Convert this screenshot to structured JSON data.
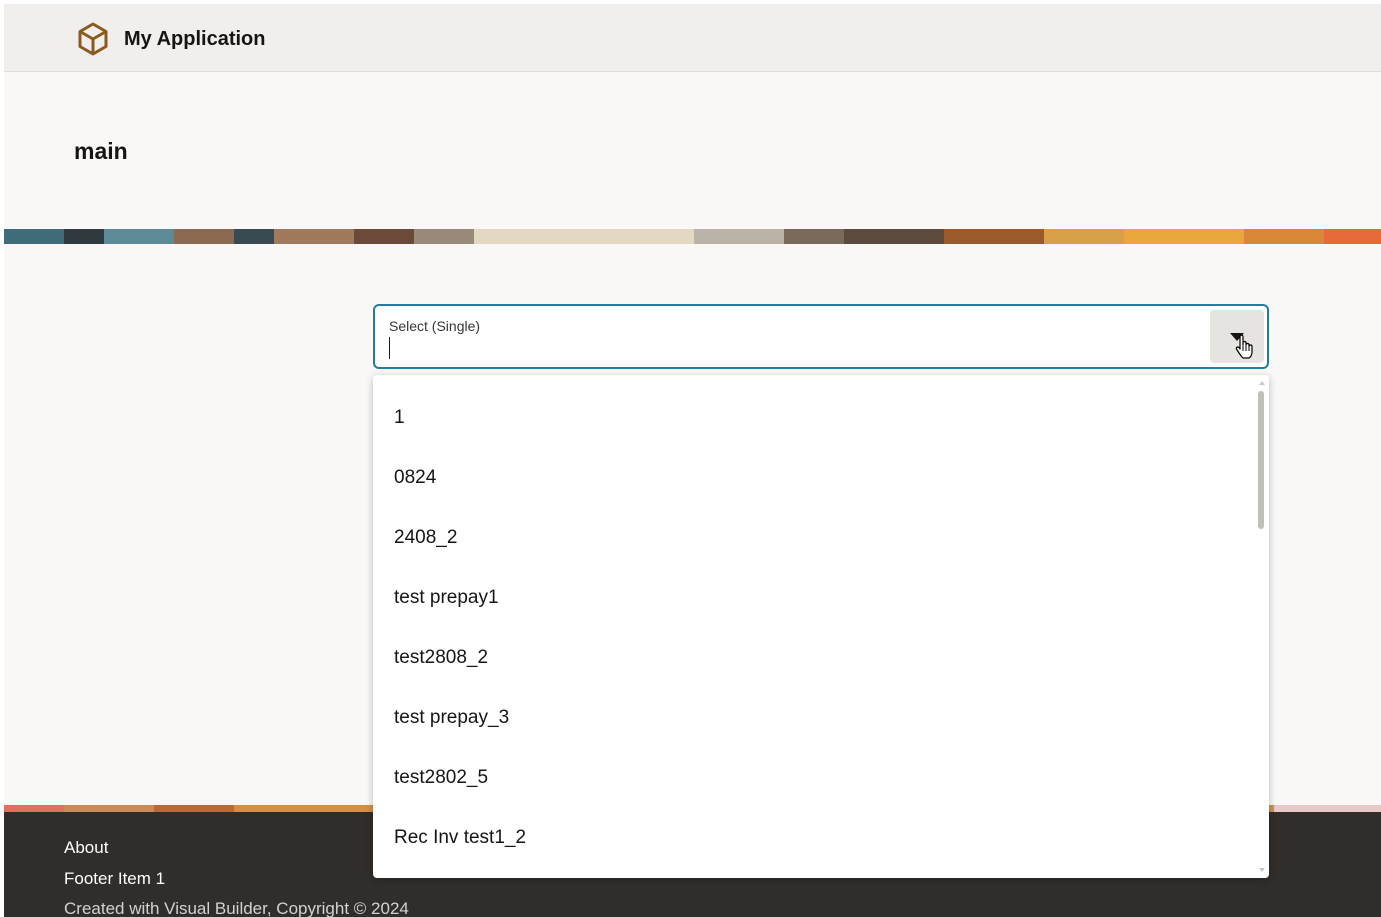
{
  "header": {
    "app_title": "My Application",
    "logo_icon": "cube-icon"
  },
  "page": {
    "title": "main"
  },
  "select": {
    "label": "Select (Single)",
    "value": "",
    "dropdown_icon": "caret-down-icon",
    "focus_color": "#227e9e"
  },
  "listbox": {
    "options": [
      "1",
      "0824",
      "2408_2",
      "test prepay1",
      "test2808_2",
      "test prepay_3",
      "test2802_5",
      "Rec Inv test1_2"
    ]
  },
  "footer": {
    "about": "About",
    "item1": "Footer Item 1",
    "copyright": "Created with Visual Builder, Copyright © 2024"
  },
  "colors": {
    "header_bg": "#f0efed",
    "page_bg": "#f9f8f6",
    "footer_bg": "#312d2a",
    "brand": "#8a5a1e"
  }
}
